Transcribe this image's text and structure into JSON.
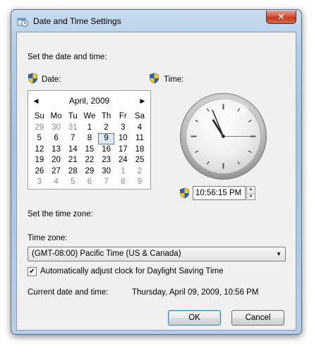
{
  "window": {
    "title": "Date and Time Settings",
    "close_glyph": "✕",
    "title_icon": "clock-settings-icon"
  },
  "main": {
    "set_date_time_label": "Set the date and time:",
    "date_label": "Date:",
    "time_label": "Time:",
    "shield_icon": "uac-shield-icon"
  },
  "calendar": {
    "title": "April, 2009",
    "prev_glyph": "◀",
    "next_glyph": "▶",
    "weekdays": [
      "Su",
      "Mo",
      "Tu",
      "We",
      "Th",
      "Fr",
      "Sa"
    ],
    "weeks": [
      [
        "29",
        "30",
        "31",
        "1",
        "2",
        "3",
        "4"
      ],
      [
        "5",
        "6",
        "7",
        "8",
        "9",
        "10",
        "11"
      ],
      [
        "12",
        "13",
        "14",
        "15",
        "16",
        "17",
        "18"
      ],
      [
        "19",
        "20",
        "21",
        "22",
        "23",
        "24",
        "25"
      ],
      [
        "26",
        "27",
        "28",
        "29",
        "30",
        "1",
        "2"
      ],
      [
        "3",
        "4",
        "5",
        "6",
        "7",
        "8",
        "9"
      ]
    ],
    "selected": "9"
  },
  "clock": {
    "hour": 10,
    "minute": 56,
    "second": 15
  },
  "time_field": {
    "value": "10:56:15 PM",
    "up_glyph": "▲",
    "down_glyph": "▼"
  },
  "timezone": {
    "section_label": "Set the time zone:",
    "field_label": "Time zone:",
    "value": "(GMT-08:00) Pacific Time (US & Canada)",
    "arrow_glyph": "▼"
  },
  "dst": {
    "checked": true,
    "check_glyph": "✔",
    "label": "Automatically adjust clock for Daylight Saving Time"
  },
  "current": {
    "label": "Current date and time:",
    "value": "Thursday, April 09, 2009, 10:56 PM"
  },
  "buttons": {
    "ok": "OK",
    "cancel": "Cancel"
  },
  "colors": {
    "window_frame": "#a9c4e0",
    "close_button": "#c03a1f",
    "dialog_background": "#f0f0f0",
    "default_button_border": "#3c7fb1"
  }
}
